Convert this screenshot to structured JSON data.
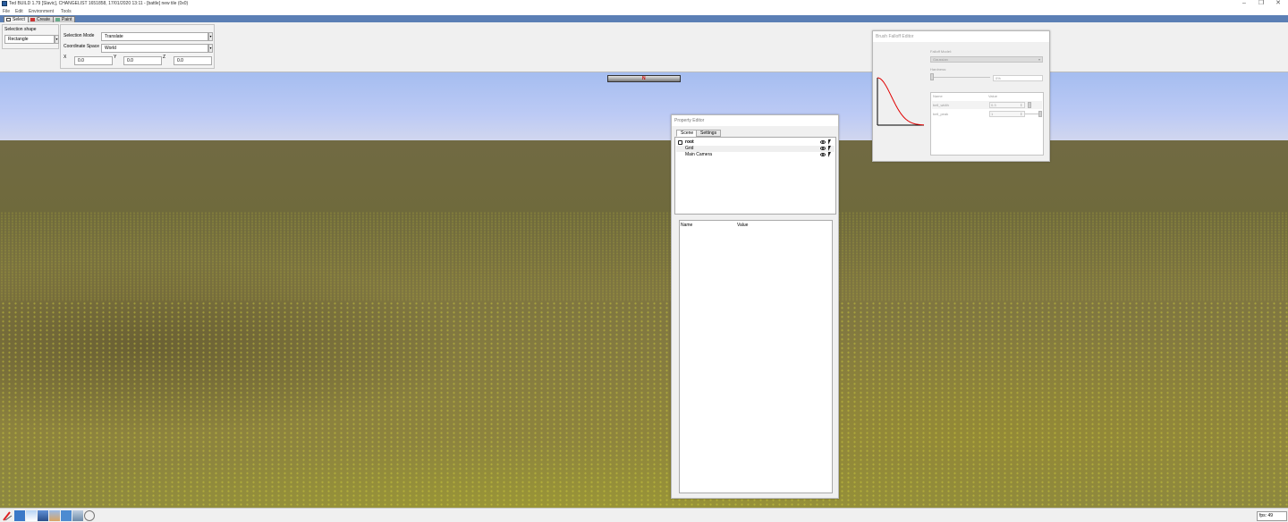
{
  "window": {
    "title": "Ted BUILD 1.79 [Slavic], CHANGELIST 1651858, 17/01/2020 13:11 - [battle] new tile (0x0)"
  },
  "menu": [
    "File",
    "Edit",
    "Environment",
    "Tools"
  ],
  "mode_tabs": [
    "Select",
    "Create",
    "Paint"
  ],
  "selection_shape": {
    "label": "Selection shape",
    "value": "Rectangle"
  },
  "transform": {
    "selection_mode_label": "Selection Mode",
    "selection_mode_value": "Translate",
    "coordinate_space_label": "Coordinate Space",
    "coordinate_space_value": "World",
    "x_label": "X",
    "x_value": "0.0",
    "y_label": "Y",
    "y_value": "0.0",
    "z_label": "Z",
    "z_value": "0.0"
  },
  "compass": {
    "label": "N"
  },
  "property_editor": {
    "title": "Property Editor",
    "tabs": [
      "Scene",
      "Settings"
    ],
    "tree": [
      "root",
      "Grid",
      "Main Camera"
    ],
    "columns": [
      "Name",
      "Value"
    ]
  },
  "brush_falloff": {
    "title": "Brush Falloff Editor",
    "model_label": "Falloff Model:",
    "model_value": "Gaussian",
    "hardness_label": "Hardness:",
    "hardness_value": "0%",
    "hardness_level": 0,
    "columns": [
      "Name",
      "Value"
    ],
    "params": [
      {
        "name": "bell_width",
        "value": "0.3"
      },
      {
        "name": "bell_peak",
        "value": "1"
      }
    ]
  },
  "status": {
    "fps": "fps: 49"
  },
  "colors": {
    "tab_strip": "#5b7fb5",
    "curve": "#e00000"
  }
}
